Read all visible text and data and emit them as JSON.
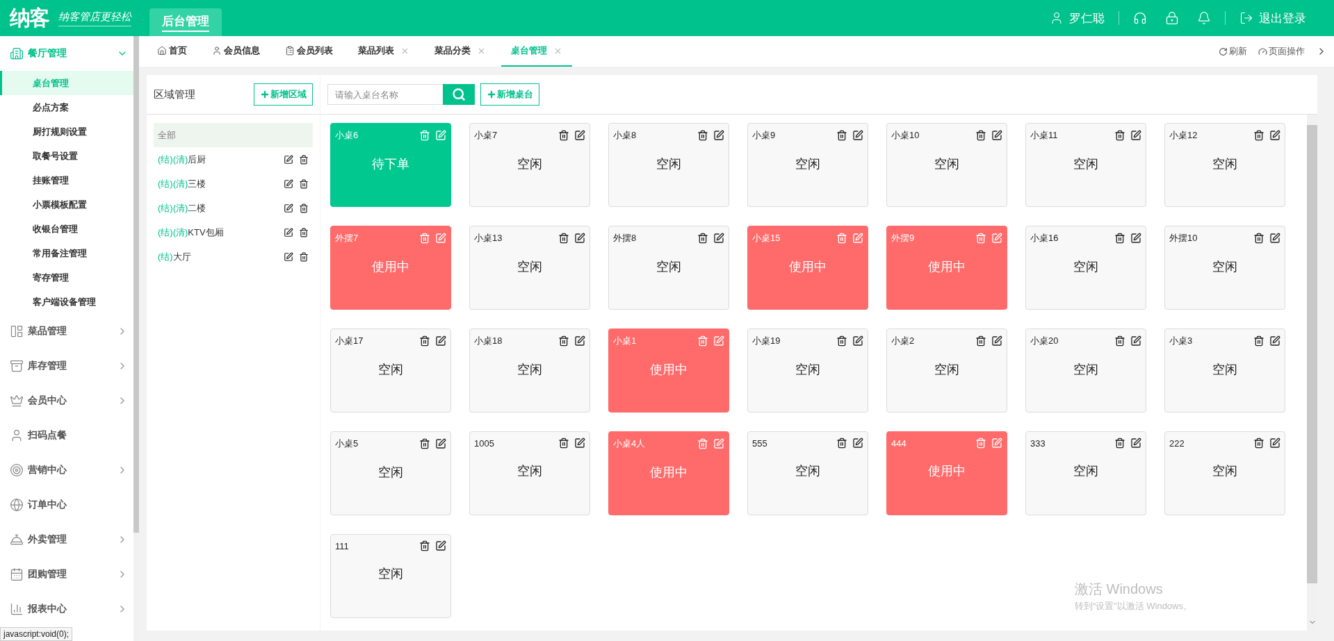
{
  "header": {
    "logo": "纳客",
    "slogan": "纳客管店更轻松",
    "nav": [
      {
        "label": "后台管理",
        "selected": true
      }
    ],
    "user": "罗仁聪",
    "logout": "退出登录"
  },
  "sidebar": {
    "sections": [
      {
        "label": "餐厅管理",
        "expandable": true,
        "expanded": true,
        "children": [
          {
            "label": "桌台管理",
            "selected": true
          },
          {
            "label": "必点方案",
            "selected": false
          },
          {
            "label": "厨打规则设置",
            "selected": false
          },
          {
            "label": "取餐号设置",
            "selected": false
          },
          {
            "label": "挂账管理",
            "selected": false
          },
          {
            "label": "小票模板配置",
            "selected": false
          },
          {
            "label": "收银台管理",
            "selected": false
          },
          {
            "label": "常用备注管理",
            "selected": false
          },
          {
            "label": "寄存管理",
            "selected": false
          },
          {
            "label": "客户端设备管理",
            "selected": false
          }
        ]
      },
      {
        "label": "菜品管理",
        "expandable": true,
        "expanded": false
      },
      {
        "label": "库存管理",
        "expandable": true,
        "expanded": false
      },
      {
        "label": "会员中心",
        "expandable": true,
        "expanded": false
      },
      {
        "label": "扫码点餐",
        "expandable": false,
        "expanded": false
      },
      {
        "label": "营销中心",
        "expandable": true,
        "expanded": false
      },
      {
        "label": "订单中心",
        "expandable": false,
        "expanded": false
      },
      {
        "label": "外卖管理",
        "expandable": true,
        "expanded": false
      },
      {
        "label": "团购管理",
        "expandable": true,
        "expanded": false
      },
      {
        "label": "报表中心",
        "expandable": true,
        "expanded": false
      }
    ]
  },
  "tabs": [
    {
      "label": "首页",
      "closable": false,
      "selected": false
    },
    {
      "label": "会员信息",
      "closable": false,
      "selected": false
    },
    {
      "label": "会员列表",
      "closable": false,
      "selected": false
    },
    {
      "label": "菜品列表",
      "closable": true,
      "selected": false
    },
    {
      "label": "菜品分类",
      "closable": true,
      "selected": false
    },
    {
      "label": "桌台管理",
      "closable": true,
      "selected": true
    }
  ],
  "tab_actions": [
    "刷新",
    "页面操作"
  ],
  "areas": {
    "title": "区域管理",
    "add_button": "新增区域",
    "items": [
      {
        "name": "全部",
        "selected": true,
        "editable": false
      },
      {
        "tags": "(结)(清)",
        "name": "后厨",
        "selected": false,
        "editable": true
      },
      {
        "tags": "(结)(清)",
        "name": "三楼",
        "selected": false,
        "editable": true
      },
      {
        "tags": "(结)(清)",
        "name": "二楼",
        "selected": false,
        "editable": true
      },
      {
        "tags": "(结)(清)",
        "name": "KTV包厢",
        "selected": false,
        "editable": true
      },
      {
        "tags": "(结)",
        "name": "大厅",
        "selected": false,
        "editable": true
      }
    ]
  },
  "tables": {
    "search": {
      "placeholder": "请输入桌台名称"
    },
    "add_button": "新增桌台",
    "items": [
      {
        "name": "小桌6",
        "status": "待下单",
        "kind": "pending"
      },
      {
        "name": "小桌7",
        "status": "空闲",
        "kind": "idle"
      },
      {
        "name": "小桌8",
        "status": "空闲",
        "kind": "idle"
      },
      {
        "name": "小桌9",
        "status": "空闲",
        "kind": "idle"
      },
      {
        "name": "小桌10",
        "status": "空闲",
        "kind": "idle"
      },
      {
        "name": "小桌11",
        "status": "空闲",
        "kind": "idle"
      },
      {
        "name": "小桌12",
        "status": "空闲",
        "kind": "idle"
      },
      {
        "name": "外摆7",
        "status": "使用中",
        "kind": "in_use"
      },
      {
        "name": "小桌13",
        "status": "空闲",
        "kind": "idle"
      },
      {
        "name": "外摆8",
        "status": "空闲",
        "kind": "idle"
      },
      {
        "name": "小桌15",
        "status": "使用中",
        "kind": "in_use"
      },
      {
        "name": "外摆9",
        "status": "使用中",
        "kind": "in_use"
      },
      {
        "name": "小桌16",
        "status": "空闲",
        "kind": "idle"
      },
      {
        "name": "外摆10",
        "status": "空闲",
        "kind": "idle"
      },
      {
        "name": "小桌17",
        "status": "空闲",
        "kind": "idle"
      },
      {
        "name": "小桌18",
        "status": "空闲",
        "kind": "idle"
      },
      {
        "name": "小桌1",
        "status": "使用中",
        "kind": "in_use"
      },
      {
        "name": "小桌19",
        "status": "空闲",
        "kind": "idle"
      },
      {
        "name": "小桌2",
        "status": "空闲",
        "kind": "idle"
      },
      {
        "name": "小桌20",
        "status": "空闲",
        "kind": "idle"
      },
      {
        "name": "小桌3",
        "status": "空闲",
        "kind": "idle"
      },
      {
        "name": "小桌5",
        "status": "空闲",
        "kind": "idle"
      },
      {
        "name": "1005",
        "status": "空闲",
        "kind": "idle"
      },
      {
        "name": "小桌4人",
        "status": "使用中",
        "kind": "in_use"
      },
      {
        "name": "555",
        "status": "空闲",
        "kind": "idle"
      },
      {
        "name": "444",
        "status": "使用中",
        "kind": "in_use"
      },
      {
        "name": "333",
        "status": "空闲",
        "kind": "idle"
      },
      {
        "name": "222",
        "status": "空闲",
        "kind": "idle"
      },
      {
        "name": "111",
        "status": "空闲",
        "kind": "idle"
      }
    ]
  },
  "os_notice": {
    "title": "激活 Windows",
    "text": "转到“设置”以激活 Windows。"
  },
  "browser_status": "javascript:void(0);"
}
